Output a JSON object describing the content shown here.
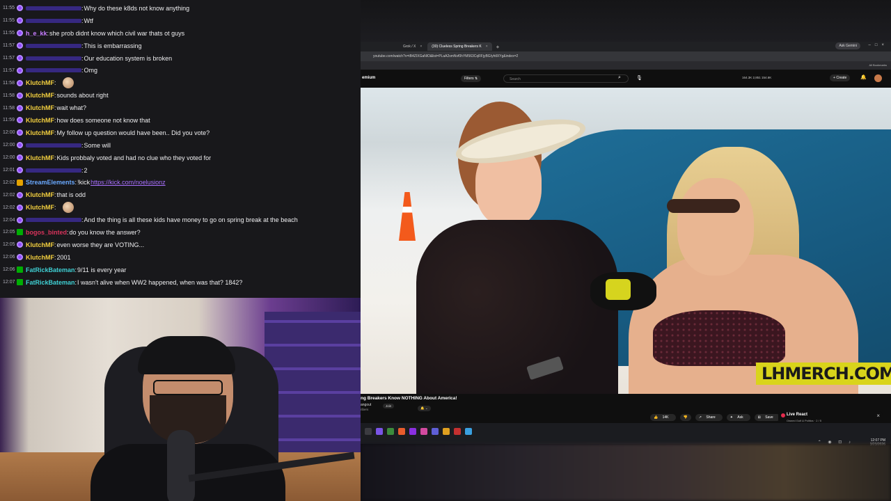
{
  "chat": {
    "messages": [
      {
        "time": "11:55",
        "user": "",
        "text": "Why do these k8ds not know anything",
        "color": "#5b3cff",
        "badge": "sub"
      },
      {
        "time": "11:55",
        "user": "",
        "text": "Wtf",
        "color": "#5b3cff",
        "badge": "sub"
      },
      {
        "time": "11:55",
        "user": "h_e_kk",
        "text": "she prob didnt know which civil war thats ot guys",
        "color": "#c77dff",
        "badge": "sub"
      },
      {
        "time": "11:57",
        "user": "",
        "text": "This is embarrassing",
        "color": "#5b3cff",
        "badge": "sub"
      },
      {
        "time": "11:57",
        "user": "",
        "text": "Our education system is broken",
        "color": "#5b3cff",
        "badge": "sub"
      },
      {
        "time": "11:57",
        "user": "",
        "text": "Omg",
        "color": "#5b3cff",
        "badge": "sub"
      },
      {
        "time": "11:58",
        "user": "KlutchMF",
        "text": "",
        "color": "#f4d03f",
        "badge": "sub",
        "emote": true
      },
      {
        "time": "11:58",
        "user": "KlutchMF",
        "text": "sounds about right",
        "color": "#f4d03f",
        "badge": "sub"
      },
      {
        "time": "11:58",
        "user": "KlutchMF",
        "text": "wait what?",
        "color": "#f4d03f",
        "badge": "sub"
      },
      {
        "time": "11:59",
        "user": "KlutchMF",
        "text": "how does someone not know that",
        "color": "#f4d03f",
        "badge": "sub"
      },
      {
        "time": "12:00",
        "user": "KlutchMF",
        "text": "My follow up question would have been.. Did you vote?",
        "color": "#f4d03f",
        "badge": "sub"
      },
      {
        "time": "12:00",
        "user": "",
        "text": "Some will",
        "color": "#5b3cff",
        "badge": "sub"
      },
      {
        "time": "12:00",
        "user": "KlutchMF",
        "text": "Kids probbaly voted and had no clue who they voted for",
        "color": "#f4d03f",
        "badge": "sub"
      },
      {
        "time": "12:01",
        "user": "",
        "text": "2",
        "color": "#5b3cff",
        "badge": "sub"
      },
      {
        "time": "12:02",
        "user": "StreamElements",
        "text": "!kick ",
        "link": "https://kick.com/noelusionz",
        "color": "#6aa9ff",
        "badge": "bot"
      },
      {
        "time": "12:02",
        "user": "KlutchMF",
        "text": "that is odd",
        "color": "#f4d03f",
        "badge": "sub"
      },
      {
        "time": "12:02",
        "user": "KlutchMF",
        "text": "",
        "color": "#f4d03f",
        "badge": "sub",
        "emote": true
      },
      {
        "time": "12:04",
        "user": "",
        "text": "And the thing is all these kids have money to go on spring break at the beach",
        "color": "#5b3cff",
        "badge": "sub"
      },
      {
        "time": "12:05",
        "user": "bogos_binted",
        "text": "do you know the answer?",
        "color": "#d8335b",
        "badge": "mod"
      },
      {
        "time": "12:05",
        "user": "KlutchMF",
        "text": "even worse they are VOTING...",
        "color": "#f4d03f",
        "badge": "sub"
      },
      {
        "time": "12:06",
        "user": "KlutchMF",
        "text": "2001",
        "color": "#f4d03f",
        "badge": "sub"
      },
      {
        "time": "12:06",
        "user": "FatRickBateman",
        "text": "9/11 is every year",
        "color": "#3fd0d4",
        "badge": "mod"
      },
      {
        "time": "12:07",
        "user": "FatRickBateman",
        "text": "I wasn't alive when WW2 happened, when was that? 1842?",
        "color": "#3fd0d4",
        "badge": "mod"
      }
    ]
  },
  "browser": {
    "tabs": [
      {
        "label": "Grok / X",
        "active": false
      },
      {
        "label": "(30) Clueless Spring Breakers K",
        "active": true
      }
    ],
    "ask_gemini": "Ask Gemini",
    "url": "youtube.com/watch?v=tB4ZIXGaNlO&list=PLaA2smNvf0hYM563CqRFjyBGIyhtlXYg&index=2",
    "all_bookmarks": "All Bookmarks"
  },
  "youtube": {
    "brand": "emium",
    "filters_label": "Filters",
    "search_placeholder": "Search",
    "stats": "164.3K  2,851  154.6K",
    "create_label": "Create",
    "video_overlay_text": "LHMERCH.COM",
    "title": "ng Breakers Know NOTHING About America!",
    "channel": "angout",
    "subs": "ribers",
    "join_label": "Join",
    "likes": "14K",
    "share_label": "Share",
    "ask_label": "Ask",
    "save_label": "Save",
    "live_react_title": "Live React",
    "live_react_sub": "Owned Golf & Politics · 2 / 5"
  },
  "taskbar": {
    "time": "12:07 PM",
    "date": "3/23/2026"
  },
  "colors": {
    "chat_bg": "#18181b",
    "link": "#a970ff",
    "overlay_yellow": "#d9d41b"
  }
}
